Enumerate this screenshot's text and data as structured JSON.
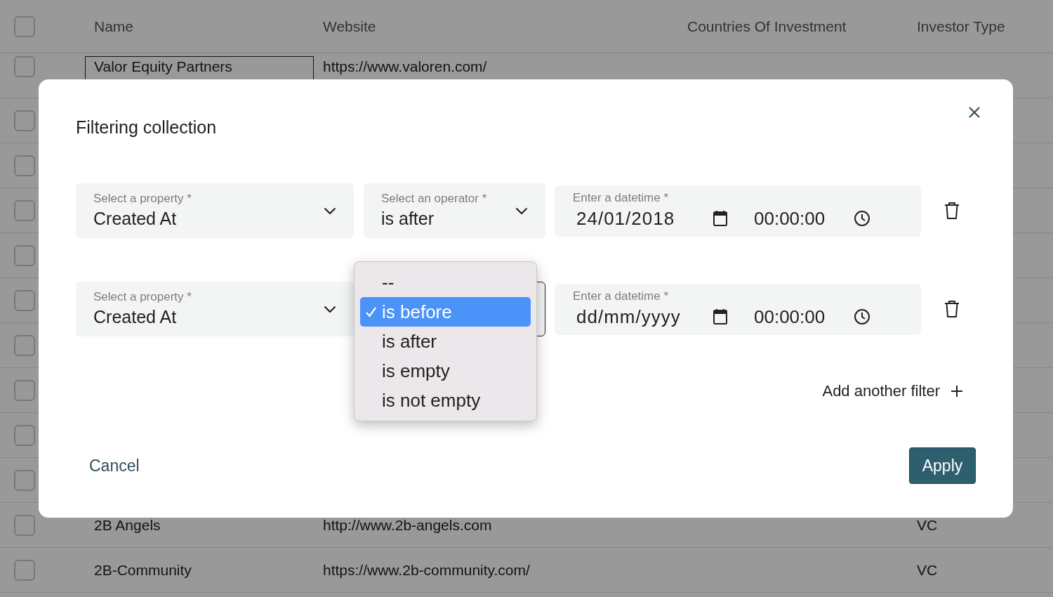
{
  "background_table": {
    "header_checked": false,
    "columns": [
      "Name",
      "Website",
      "Countries Of Investment",
      "Investor Type"
    ],
    "rows": [
      {
        "checked": false,
        "name": "Valor Equity Partners",
        "website": "https://www.valoren.com/"
      },
      {
        "checked": false
      },
      {
        "checked": false
      },
      {
        "checked": false
      },
      {
        "checked": false
      },
      {
        "checked": false
      },
      {
        "checked": false
      },
      {
        "checked": false
      },
      {
        "checked": false
      },
      {
        "checked": false
      },
      {
        "checked": false,
        "name": "2B Angels",
        "website": "http://www.2b-angels.com",
        "investor_type": "VC"
      },
      {
        "checked": false,
        "name": "2B-Community",
        "website": "https://www.2b-community.com/",
        "investor_type": "VC"
      }
    ]
  },
  "dialog": {
    "title": "Filtering collection",
    "filters": [
      {
        "property": {
          "label": "Select a property *",
          "value": "Created At"
        },
        "operator": {
          "label": "Select an operator *",
          "value": "is after",
          "open": false
        },
        "datetime": {
          "label": "Enter a datetime *",
          "date": "24/01/2018",
          "time": "00:00:00"
        }
      },
      {
        "property": {
          "label": "Select a property *",
          "value": "Created At"
        },
        "operator": {
          "open": true,
          "options": [
            {
              "label": "--",
              "selected": false
            },
            {
              "label": "is before",
              "selected": true
            },
            {
              "label": "is after",
              "selected": false
            },
            {
              "label": "is empty",
              "selected": false
            },
            {
              "label": "is not empty",
              "selected": false
            }
          ]
        },
        "datetime": {
          "label": "Enter a datetime *",
          "placeholder": "dd/mm/yyyy",
          "time": "00:00:00"
        }
      }
    ],
    "add_filter": "Add another filter",
    "cancel": "Cancel",
    "apply": "Apply"
  }
}
